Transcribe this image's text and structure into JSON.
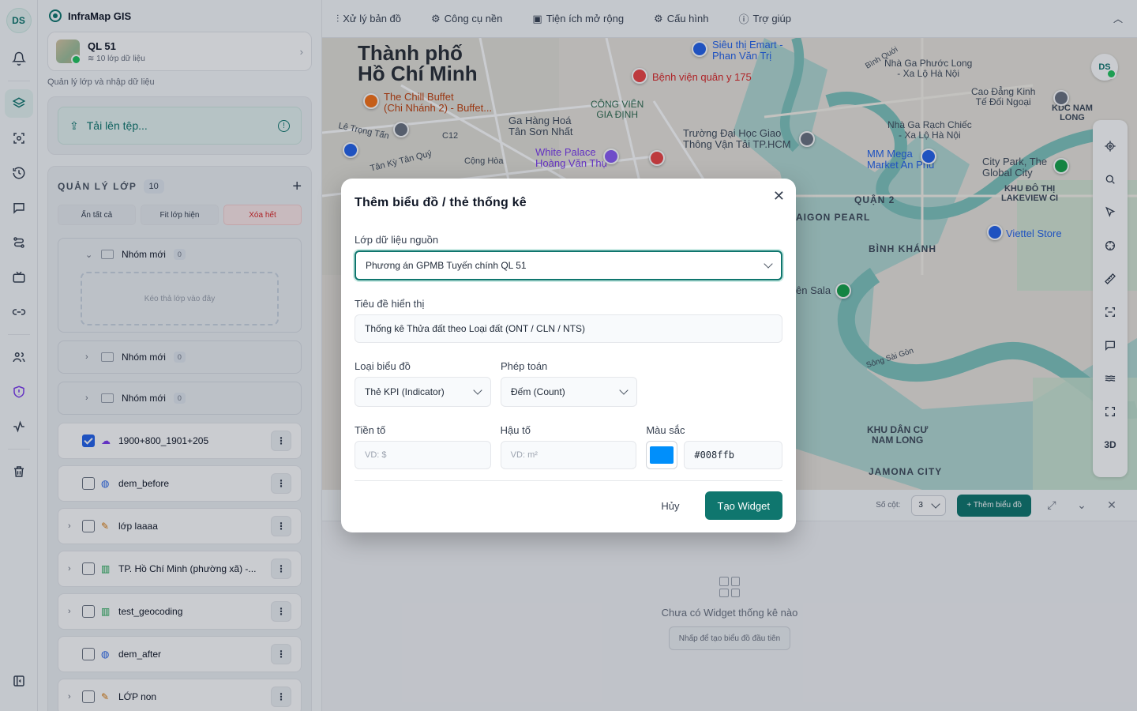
{
  "app": {
    "name": "InfraMap GIS",
    "user_initials": "DS"
  },
  "project": {
    "name": "QL 51",
    "subtitle": "10 lớp dữ liệu"
  },
  "panel": {
    "hint": "Quản lý lớp và nhập dữ liệu",
    "upload_label": "Tải lên tệp...",
    "layers_title": "QUẢN LÝ LỚP",
    "layers_count": "10",
    "actions": {
      "hide_all": "Ẩn tất cả",
      "fit": "Fit lớp hiện",
      "delete_all": "Xóa hết"
    },
    "group_name": "Nhóm mới",
    "group_count": "0",
    "drop_hint": "Kéo thả lớp vào đây",
    "layers": [
      {
        "name": "1900+800_1901+205",
        "checked": true,
        "expandable": false,
        "icon": "cloud-icon"
      },
      {
        "name": "dem_before",
        "checked": false,
        "expandable": false,
        "icon": "globe-icon"
      },
      {
        "name": "lớp laaaa",
        "checked": false,
        "expandable": true,
        "icon": "ruler-icon"
      },
      {
        "name": "TP. Hồ Chí Minh (phường xã) -...",
        "checked": false,
        "expandable": true,
        "icon": "map-icon"
      },
      {
        "name": "test_geocoding",
        "checked": false,
        "expandable": true,
        "icon": "map-icon"
      },
      {
        "name": "dem_after",
        "checked": false,
        "expandable": false,
        "icon": "globe-icon"
      },
      {
        "name": "LỚP non",
        "checked": false,
        "expandable": true,
        "icon": "ruler-icon"
      }
    ]
  },
  "toolbar": {
    "items": [
      "Xử lý bản đồ",
      "Công cụ nền",
      "Tiện ích mở rộng",
      "Cấu hình",
      "Trợ giúp"
    ]
  },
  "map": {
    "labels": {
      "city": "Thành phố\nHồ Chí Minh",
      "sieu_thi": "Siêu thị Emart -\nPhan Văn Trị",
      "benh_vien": "Bệnh viện quân y 175",
      "chill": "The Chill Buffet\n(Chi Nhánh 2) - Buffet...",
      "cong_vien": "CÔNG VIÊN\nGIA ĐỊNH",
      "ga_hang_hoa": "Ga Hàng Hoá\nTân Sơn Nhất",
      "white_palace": "White Palace\nHoàng Văn Thụ",
      "truong_dh": "Trường Đại Học Giao\nThông Vận Tải TP.HCM",
      "ga_phuoc_long": "Nhà Ga Phước Long\n- Xa Lộ Hà Nội",
      "cao_dang": "Cao Đẳng Kinh\nTế Đối Ngoại",
      "ga_rach_chiec": "Nhà Ga Rạch Chiếc\n- Xa Lộ Hà Nội",
      "mm_mega": "MM Mega\nMarket An Phú",
      "city_park": "City Park, The\nGlobal City",
      "quan2": "QUẬN 2",
      "binh_khanh": "BÌNH KHÁNH",
      "viettel": "Viettel Store",
      "khu_dan_cu": "KHU DÂN CƯ\nNAM LONG",
      "jamona": "JAMONA CITY",
      "saigon_pearl": "AIGON PEARL",
      "kdc_nam_long": "KDC NAM\nLONG",
      "khu_do_thi": "KHU ĐÔ THỊ\nLAKEVIEW CI",
      "en_sala": "ên Sala",
      "le_trong_tan": "Lê Trọng Tấn",
      "tan_ky": "Tân Kỳ Tân Quý",
      "cong_hoa": "Cộng Hòa",
      "c12": "C12",
      "binh_quoi": "Bình Quới",
      "song_sai_gon": "Sông Sài Gòn"
    },
    "tools_3d": "3D"
  },
  "dashboard": {
    "columns_label": "Số cột:",
    "columns_value": "3",
    "add_button": "+ Thêm biểu đồ",
    "empty_text": "Chưa có Widget thống kê nào",
    "empty_button": "Nhấp để tạo biểu đồ đầu tiên"
  },
  "modal": {
    "title": "Thêm biểu đồ / thẻ thống kê",
    "source_label": "Lớp dữ liệu nguồn",
    "source_value": "Phương án GPMB Tuyến chính QL 51",
    "display_title_label": "Tiêu đề hiển thị",
    "display_title_value": "Thống kê Thửa đất theo Loại đất (ONT / CLN / NTS)",
    "chart_type_label": "Loại biểu đồ",
    "chart_type_value": "Thẻ KPI (Indicator)",
    "operation_label": "Phép toán",
    "operation_value": "Đếm (Count)",
    "prefix_label": "Tiền tố",
    "prefix_placeholder": "VD: $",
    "suffix_label": "Hậu tố",
    "suffix_placeholder": "VD: m²",
    "color_label": "Màu sắc",
    "color_value": "#008ffb",
    "cancel": "Hủy",
    "create": "Tạo Widget"
  },
  "colors": {
    "accent": "#0f766e",
    "swatch": "#008ffb"
  }
}
